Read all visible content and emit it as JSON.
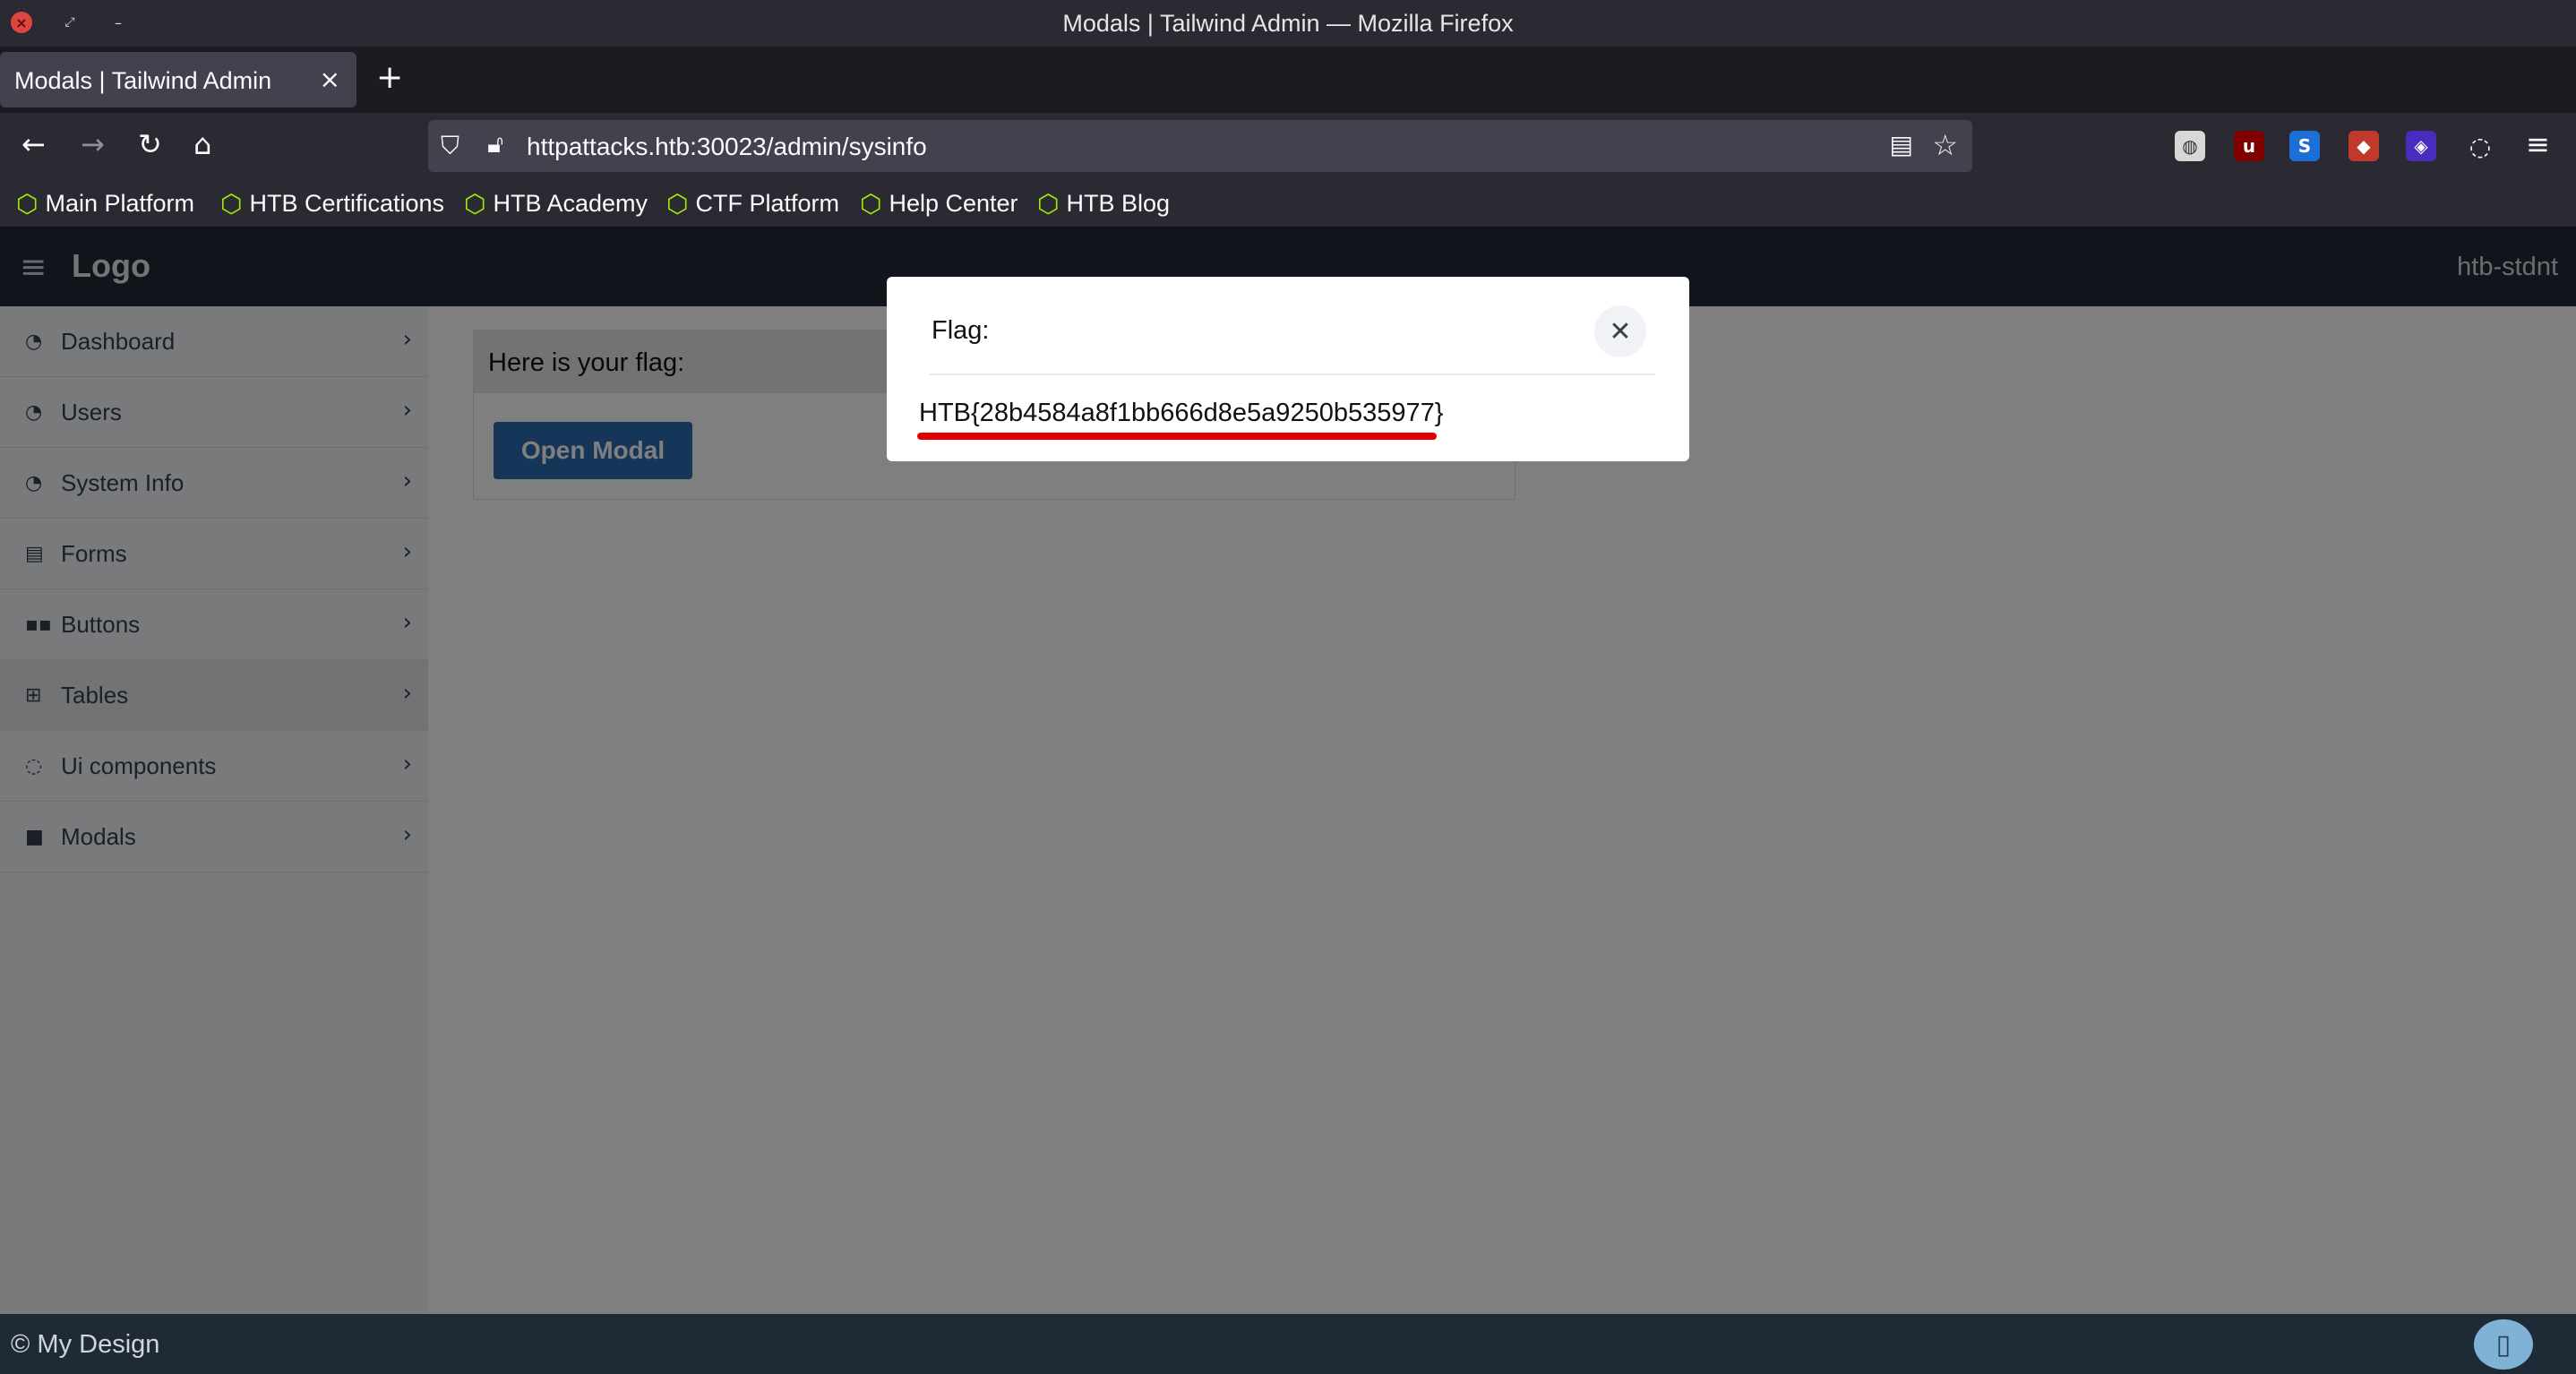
{
  "window": {
    "title": "Modals | Tailwind Admin — Mozilla Firefox"
  },
  "browser": {
    "tab_title": "Modals | Tailwind Admin",
    "url": "httpattacks.htb:30023/admin/sysinfo",
    "bookmarks": [
      {
        "label": "Main Platform"
      },
      {
        "label": "HTB Certifications"
      },
      {
        "label": "HTB Academy"
      },
      {
        "label": "CTF Platform"
      },
      {
        "label": "Help Center"
      },
      {
        "label": "HTB Blog"
      }
    ],
    "extensions": [
      "ext-icon-1",
      "ublock-icon",
      "s-icon",
      "fox-icon",
      "diamond-icon",
      "cookie-icon"
    ]
  },
  "header": {
    "logo": "Logo",
    "user": "htb-stdnt"
  },
  "sidebar": {
    "items": [
      {
        "label": "Dashboard",
        "icon": "gauge-icon"
      },
      {
        "label": "Users",
        "icon": "gauge-icon"
      },
      {
        "label": "System Info",
        "icon": "gauge-icon"
      },
      {
        "label": "Forms",
        "icon": "form-icon"
      },
      {
        "label": "Buttons",
        "icon": "grid-icon"
      },
      {
        "label": "Tables",
        "icon": "table-icon"
      },
      {
        "label": "Ui components",
        "icon": "spinner-icon"
      },
      {
        "label": "Modals",
        "icon": "square-icon"
      }
    ],
    "active_index": 5
  },
  "main": {
    "card_title": "Here is your flag:",
    "open_modal_label": "Open Modal"
  },
  "modal": {
    "title": "Flag:",
    "flag": "HTB{28b4584a8f1bb666d8e5a9250b535977}",
    "highlight_color": "#e10000"
  },
  "footer": {
    "text": "© My Design"
  }
}
